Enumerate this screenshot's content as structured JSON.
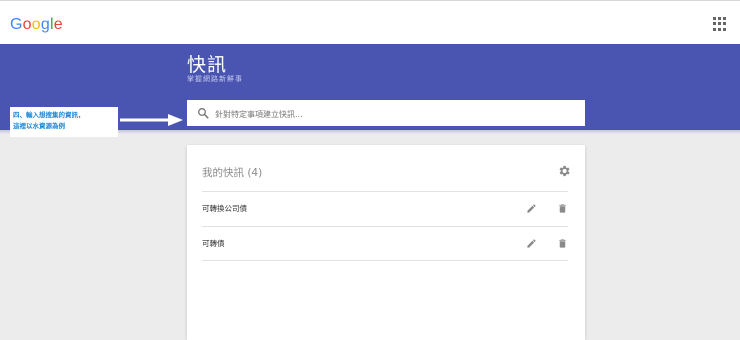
{
  "header": {
    "logo_letters": [
      {
        "ch": "G",
        "color": "#4285f4"
      },
      {
        "ch": "o",
        "color": "#ea4335"
      },
      {
        "ch": "o",
        "color": "#fbbc05"
      },
      {
        "ch": "g",
        "color": "#4285f4"
      },
      {
        "ch": "l",
        "color": "#34a853"
      },
      {
        "ch": "e",
        "color": "#ea4335"
      }
    ],
    "apps_icon": "apps-grid-icon"
  },
  "hero": {
    "title": "快訊",
    "subtitle": "掌握網路新鮮事",
    "background": "#4a55b2"
  },
  "search": {
    "placeholder": "針對特定事項建立快訊...",
    "value": "",
    "icon": "search-icon"
  },
  "annotation": {
    "line1": "四、輸入想搜集的資訊，",
    "line2": "這裡以水資源為例",
    "color": "#1a88d8"
  },
  "alerts": {
    "title": "我的快訊 (4)",
    "settings_icon": "gear-icon",
    "items": [
      {
        "label": "可轉換公司債",
        "edit_icon": "pencil-icon",
        "delete_icon": "trash-icon"
      },
      {
        "label": "可轉債",
        "edit_icon": "pencil-icon",
        "delete_icon": "trash-icon"
      }
    ]
  }
}
